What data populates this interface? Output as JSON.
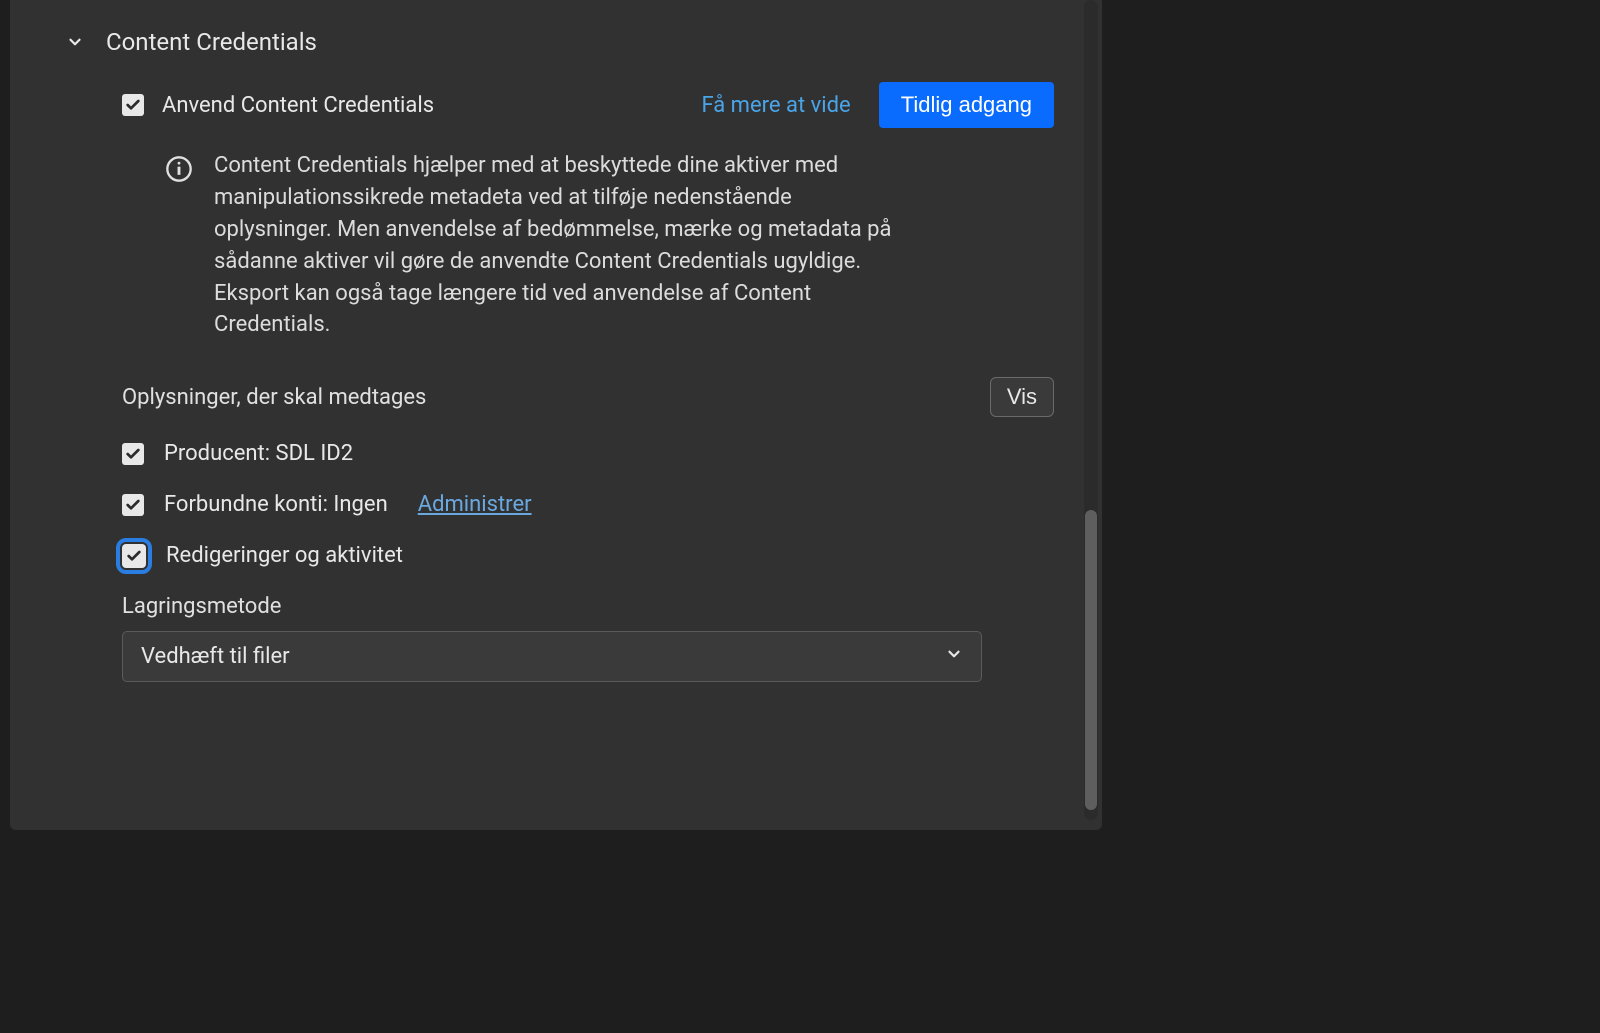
{
  "section": {
    "title": "Content Credentials"
  },
  "apply": {
    "label": "Anvend Content Credentials",
    "learn_more": "Få mere at vide",
    "badge": "Tidlig adgang"
  },
  "info": {
    "text": "Content Credentials hjælper med at beskyttede dine aktiver med manipulationssikrede metadeta ved at tilføje nedenstående oplysninger. Men anvendelse af bedømmelse, mærke og metadata på sådanne aktiver vil gøre de anvendte Content Credentials ugyldige. Eksport kan også tage længere tid ved anvendelse af Content Credentials."
  },
  "include": {
    "header": "Oplysninger, der skal medtages",
    "show_btn": "Vis",
    "producer": "Producent: SDL ID2",
    "accounts": "Forbundne konti: Ingen",
    "manage": "Administrer",
    "edits": "Redigeringer og aktivitet"
  },
  "storage": {
    "label": "Lagringsmetode",
    "selected": "Vedhæft til filer"
  }
}
